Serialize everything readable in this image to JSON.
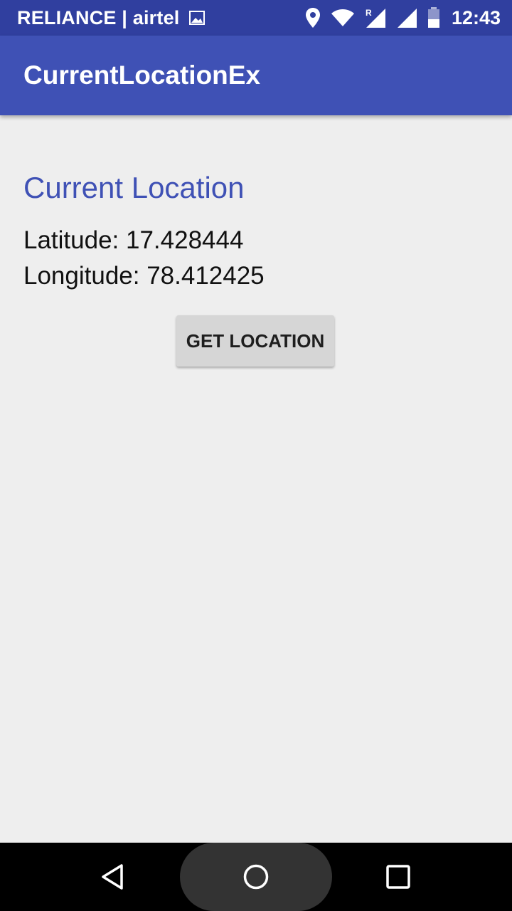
{
  "status_bar": {
    "carrier": "RELIANCE | airtel",
    "time": "12:43",
    "icons": [
      "gallery-icon",
      "location-pin-icon",
      "wifi-icon",
      "roaming-signal-icon",
      "signal-icon",
      "battery-icon"
    ],
    "roaming_label": "R"
  },
  "app_bar": {
    "title": "CurrentLocationEx",
    "color": "#3f51b5"
  },
  "main": {
    "heading": "Current Location",
    "latitude_text": "Latitude: 17.428444",
    "longitude_text": "Longitude: 78.412425",
    "get_location_label": "GET LOCATION"
  },
  "nav_bar": {
    "icons": [
      "back-icon",
      "home-icon",
      "recents-icon"
    ]
  },
  "colors": {
    "status_bar": "#303f9f",
    "app_bar": "#3f51b5",
    "accent_text": "#3f51b5",
    "background": "#eeeeee",
    "button": "#d6d6d6"
  }
}
